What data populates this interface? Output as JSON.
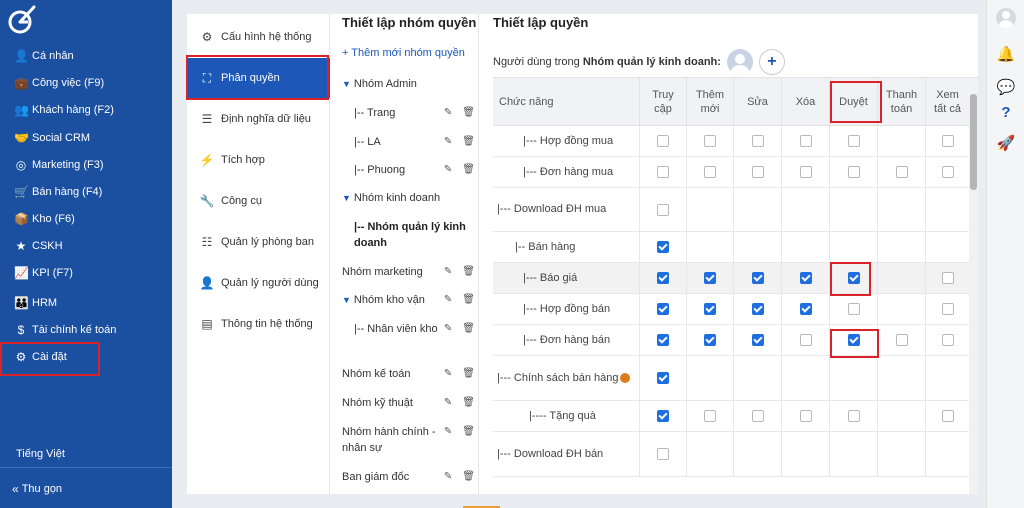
{
  "colors": {
    "sidebar": "#1b4fa0",
    "accent": "#1d58b8",
    "highlight": "#d9222a",
    "checked": "#1d6fe0"
  },
  "sidebar": {
    "items": [
      {
        "label": "Cá nhân",
        "icon": "user-icon",
        "glyph": "👤"
      },
      {
        "label": "Công việc (F9)",
        "icon": "briefcase-icon",
        "glyph": "💼"
      },
      {
        "label": "Khách hàng (F2)",
        "icon": "users-icon",
        "glyph": "👥"
      },
      {
        "label": "Social CRM",
        "icon": "handshake-icon",
        "glyph": "🤝"
      },
      {
        "label": "Marketing (F3)",
        "icon": "target-icon",
        "glyph": "◎"
      },
      {
        "label": "Bán hàng (F4)",
        "icon": "cart-icon",
        "glyph": "🛒"
      },
      {
        "label": "Kho (F6)",
        "icon": "boxes-icon",
        "glyph": "📦"
      },
      {
        "label": "CSKH",
        "icon": "star-icon",
        "glyph": "★"
      },
      {
        "label": "KPI (F7)",
        "icon": "chart-icon",
        "glyph": "📈"
      },
      {
        "label": "HRM",
        "icon": "team-icon",
        "glyph": "👪"
      },
      {
        "label": "Tài chính kế toán",
        "icon": "dollar-icon",
        "glyph": "$"
      },
      {
        "label": "Cài đặt",
        "icon": "gear-icon",
        "glyph": "⚙"
      }
    ],
    "language": "Tiếng Việt",
    "collapse": "Thu gọn",
    "collapse_glyph": "«"
  },
  "settings_menu": {
    "items": [
      {
        "label": "Cấu hình hệ thống",
        "icon": "cogs-icon",
        "glyph": "⚙"
      },
      {
        "label": "Phân quyền",
        "icon": "sitemap-icon",
        "glyph": "⛶"
      },
      {
        "label": "Định nghĩa dữ liệu",
        "icon": "list-icon",
        "glyph": "☰"
      },
      {
        "label": "Tích hợp",
        "icon": "plug-icon",
        "glyph": "⚡"
      },
      {
        "label": "Công cụ",
        "icon": "wrench-icon",
        "glyph": "🔧"
      },
      {
        "label": "Quản lý phòng ban",
        "icon": "sliders-icon",
        "glyph": "☷"
      },
      {
        "label": "Quản lý người dùng",
        "icon": "user-card-icon",
        "glyph": "👤"
      },
      {
        "label": "Thông tin hệ thống",
        "icon": "server-icon",
        "glyph": "▤"
      }
    ]
  },
  "groups": {
    "title": "Thiết lập nhóm quyền",
    "add_label": "+ Thêm mới nhóm quyền",
    "edit_glyph": "✎",
    "delete_glyph": "🗑",
    "caret_glyph": "▼",
    "rows": [
      {
        "label": "Nhóm Admin",
        "caret": true,
        "actions": false
      },
      {
        "label": "|-- Trang",
        "caret": false,
        "actions": true
      },
      {
        "label": "|-- LA",
        "caret": false,
        "actions": true
      },
      {
        "label": "|-- Phuong",
        "caret": false,
        "actions": true
      },
      {
        "label": "Nhóm kinh doanh",
        "caret": true,
        "actions": false
      },
      {
        "label": "|-- Nhóm quản lý kinh doanh",
        "caret": false,
        "actions": false,
        "bold": true
      },
      {
        "label": "Nhóm marketing",
        "caret": false,
        "actions": true
      },
      {
        "label": "Nhóm kho vận",
        "caret": true,
        "actions": true
      },
      {
        "label": "|-- Nhân viên kho",
        "caret": false,
        "actions": true
      },
      {
        "label": "Nhóm kế toán",
        "caret": false,
        "actions": true
      },
      {
        "label": "Nhóm kỹ thuật",
        "caret": false,
        "actions": true
      },
      {
        "label": "Nhóm hành chính - nhân sự",
        "caret": false,
        "actions": true
      },
      {
        "label": "Ban giám đốc",
        "caret": false,
        "actions": true
      }
    ]
  },
  "permissions": {
    "title": "Thiết lập quyền",
    "user_prefix": "Người dùng trong",
    "group_name": "Nhóm quản lý kinh doanh:",
    "add_glyph": "+",
    "columns": [
      "Chức năng",
      "Truy cập",
      "Thêm mới",
      "Sửa",
      "Xóa",
      "Duyệt",
      "Thanh toán",
      "Xem tất cả"
    ],
    "rows": [
      {
        "name": "|--- Hợp đồng mua",
        "cells": [
          0,
          0,
          0,
          0,
          0,
          null,
          0
        ]
      },
      {
        "name": "|--- Đơn hàng mua",
        "cells": [
          0,
          0,
          0,
          0,
          0,
          0,
          0
        ]
      },
      {
        "name": "|--- Download ĐH mua",
        "cells": [
          0,
          null,
          null,
          null,
          null,
          null,
          null
        ]
      },
      {
        "name": "|-- Bán hàng",
        "cells": [
          1,
          null,
          null,
          null,
          null,
          null,
          null
        ]
      },
      {
        "name": "|--- Báo giá",
        "cells": [
          1,
          1,
          1,
          1,
          1,
          null,
          0
        ],
        "shade": true
      },
      {
        "name": "|--- Hợp đồng bán",
        "cells": [
          1,
          1,
          1,
          1,
          0,
          null,
          0
        ]
      },
      {
        "name": "|--- Đơn hàng bán",
        "cells": [
          1,
          1,
          1,
          0,
          1,
          0,
          0
        ]
      },
      {
        "name": "|--- Chính sách bán hàng",
        "cells": [
          1,
          null,
          null,
          null,
          null,
          null,
          null
        ],
        "info": true
      },
      {
        "name": "|---- Tặng quà",
        "cells": [
          1,
          0,
          0,
          0,
          0,
          null,
          0
        ]
      },
      {
        "name": "|--- Download ĐH bán",
        "cells": [
          0,
          null,
          null,
          null,
          null,
          null,
          null
        ]
      }
    ]
  },
  "right_toolbar": [
    {
      "icon": "bell-icon",
      "glyph": "🔔"
    },
    {
      "icon": "chat-icon",
      "glyph": "💬"
    },
    {
      "icon": "help-icon",
      "glyph": "?"
    },
    {
      "icon": "rocket-icon",
      "glyph": "🚀"
    }
  ]
}
